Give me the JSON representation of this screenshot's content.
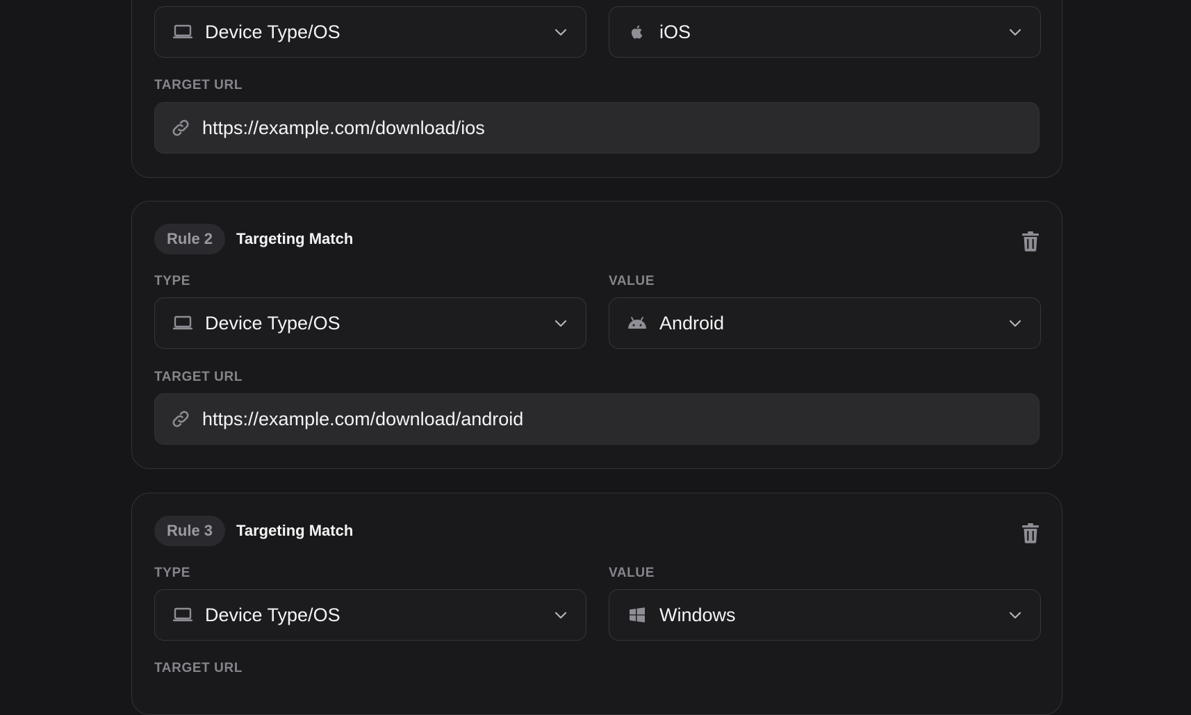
{
  "rules": [
    {
      "type_value": "Device Type/OS",
      "value": "iOS",
      "value_icon": "apple-icon",
      "target_url_label": "TARGET URL",
      "target_url": "https://example.com/download/ios"
    },
    {
      "pill": "Rule 2",
      "title": "Targeting Match",
      "type_label": "TYPE",
      "value_label": "VALUE",
      "type_value": "Device Type/OS",
      "value": "Android",
      "value_icon": "android-icon",
      "target_url_label": "TARGET URL",
      "target_url": "https://example.com/download/android"
    },
    {
      "pill": "Rule 3",
      "title": "Targeting Match",
      "type_label": "TYPE",
      "value_label": "VALUE",
      "type_value": "Device Type/OS",
      "value": "Windows",
      "value_icon": "windows-icon",
      "target_url_label": "TARGET URL"
    }
  ],
  "colors": {
    "background": "#161618",
    "card": "#19191b",
    "border": "#333337",
    "input": "#2a2a2d",
    "label": "#85858c",
    "text": "#f4f4f5"
  }
}
